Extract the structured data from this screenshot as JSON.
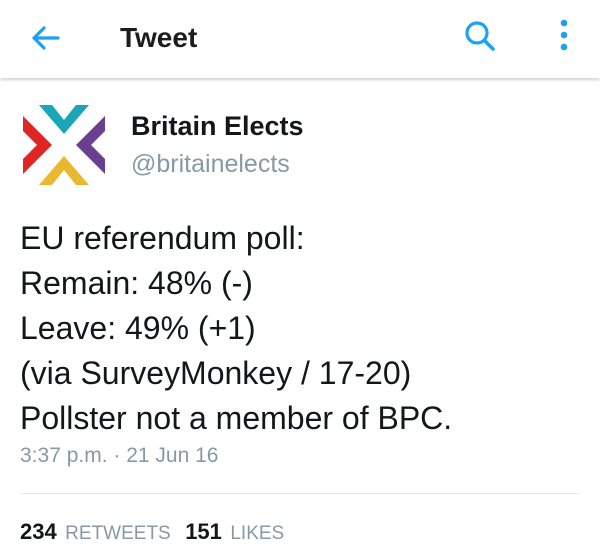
{
  "colors": {
    "accent": "#1da1f2",
    "text_primary": "#14171a",
    "text_secondary": "#8899a6",
    "logo_red": "#e02525",
    "logo_teal": "#1aa6b7",
    "logo_purple": "#6a3f8f",
    "logo_yellow": "#e8b82e"
  },
  "appbar": {
    "title": "Tweet",
    "back_icon": "arrow-left-icon",
    "search_icon": "search-icon",
    "overflow_icon": "more-vertical-icon"
  },
  "tweet": {
    "author_name": "Britain Elects",
    "author_handle": "@britainelects",
    "lines": [
      "EU referendum poll:",
      "Remain: 48% (-)",
      "Leave: 49% (+1)",
      "(via SurveyMonkey / 17-20)",
      "Pollster not a member of BPC."
    ],
    "timestamp": "3:37 p.m. · 21 Jun 16",
    "retweets": {
      "count": "234",
      "label": "RETWEETS"
    },
    "likes": {
      "count": "151",
      "label": "LIKES"
    }
  }
}
